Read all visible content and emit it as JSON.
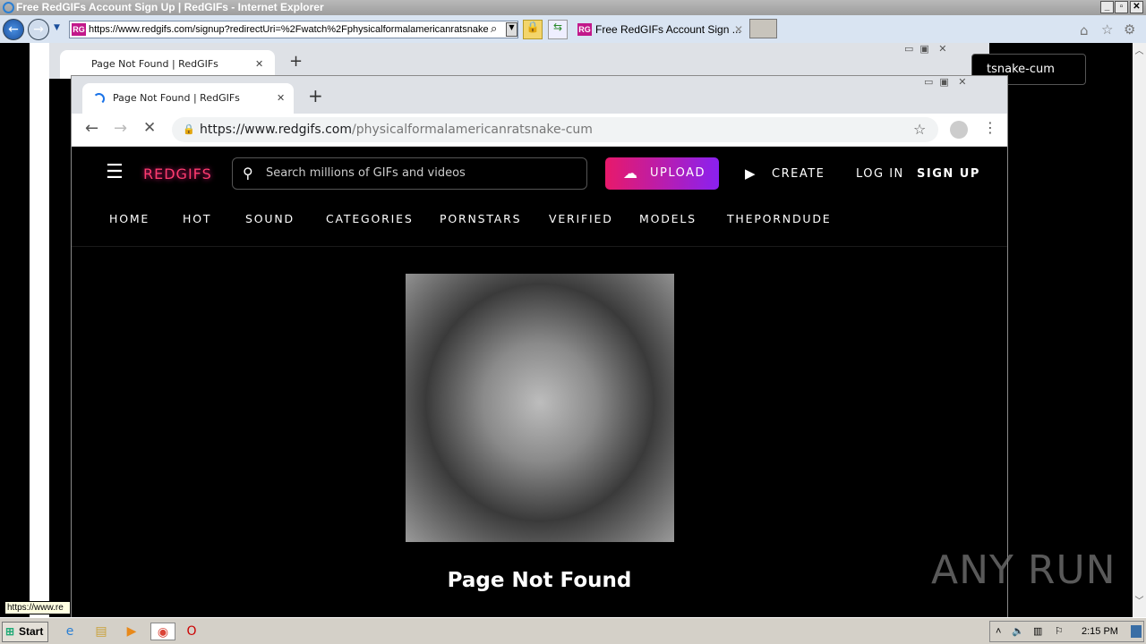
{
  "ie": {
    "title": "Free RedGIFs Account Sign Up | RedGIFs - Internet Explorer",
    "address": "https://www.redgifs.com/signup?redirectUri=%2Fwatch%2Fphysicalformalamericanratsnake",
    "tab_label": "Free RedGIFs Account Sign ...",
    "favicon": "RG",
    "status_tip": "https://www.re"
  },
  "background_window": {
    "tab_title": "Page Not Found | RedGIFs",
    "url_fragment": "tsnake-cum"
  },
  "chrome": {
    "tab_title": "Page Not Found | RedGIFs",
    "url_host": "https://www.redgifs.com",
    "url_path": "/physicalformalamericanratsnake-cum"
  },
  "site": {
    "logo": "REDGIFS",
    "search_placeholder": "Search millions of GIFs and videos",
    "upload": "UPLOAD",
    "create": "CREATE",
    "login": "LOG IN",
    "signup": "SIGN UP",
    "nav": [
      "HOME",
      "HOT",
      "SOUND",
      "CATEGORIES",
      "PORNSTARS",
      "VERIFIED",
      "MODELS",
      "THEPORNDUDE"
    ],
    "message": "Page Not Found",
    "accent": "#e8196a"
  },
  "watermark": "ANY RUN",
  "taskbar": {
    "start": "Start",
    "clock": "2:15 PM"
  }
}
